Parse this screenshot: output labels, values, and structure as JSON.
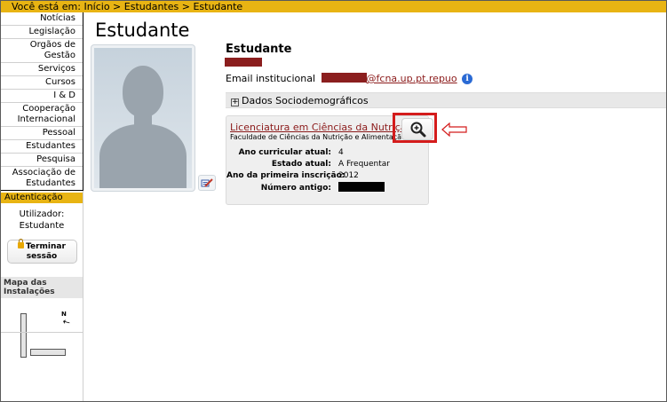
{
  "breadcrumb": {
    "text": "Você está em: Início > Estudantes > Estudante"
  },
  "sidebar": {
    "items": [
      {
        "label": "Notícias"
      },
      {
        "label": "Legislação"
      },
      {
        "label": "Orgãos de Gestão"
      },
      {
        "label": "Serviços"
      },
      {
        "label": "Cursos"
      },
      {
        "label": "I & D"
      },
      {
        "label": "Cooperação Internacional"
      },
      {
        "label": "Pessoal"
      },
      {
        "label": "Estudantes"
      },
      {
        "label": "Pesquisa"
      },
      {
        "label": "Associação de Estudantes"
      }
    ],
    "auth": {
      "heading": "Autenticação",
      "user_label": "Utilizador:",
      "user_value": "Estudante",
      "logout_label": "Terminar sessão"
    },
    "map": {
      "heading": "Mapa das Instalações",
      "north_label": "N"
    }
  },
  "main": {
    "page_title": "Estudante",
    "profile": {
      "name_heading": "Estudante",
      "email_label": "Email institucional",
      "email_domain": "@fcna.up.pt.repuo",
      "info_icon": "i"
    },
    "socio": {
      "toggle": "+",
      "label": "Dados Sociodemográficos"
    },
    "course": {
      "name": "Licenciatura em Ciências da Nutrição",
      "faculty": "Faculdade de Ciências da Nutrição e Alimentação",
      "rows": [
        {
          "label": "Ano curricular atual:",
          "value": "4"
        },
        {
          "label": "Estado atual:",
          "value": "A Frequentar"
        },
        {
          "label": "Ano da primeira inscrição:",
          "value": "2012"
        },
        {
          "label": "Número antigo:",
          "value": ""
        }
      ]
    }
  },
  "colors": {
    "accent": "#e8b413",
    "link": "#8b1a1a",
    "highlight": "#d41c1c",
    "redaction_red": "#8b1e1e",
    "redaction_black": "#000000"
  },
  "icons": [
    "lock-icon",
    "compass-north-icon",
    "edit-photo-icon",
    "info-icon",
    "expand-icon",
    "zoom-in-icon",
    "arrow-left-icon"
  ]
}
